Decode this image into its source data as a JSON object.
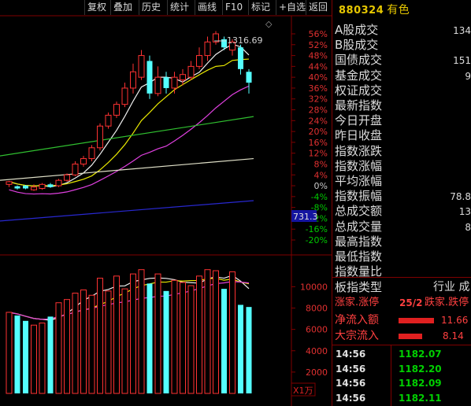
{
  "toolbar": {
    "items": [
      "复权",
      "叠加",
      "历史",
      "统计",
      "画线",
      "F10",
      "标记",
      "+自选",
      "返回"
    ]
  },
  "chart": {
    "high_label": "1316.69",
    "marker": "◇",
    "cursor_value": "731.3",
    "y_axis_pct": [
      "56%",
      "52%",
      "48%",
      "44%",
      "40%",
      "36%",
      "32%",
      "28%",
      "24%",
      "20%",
      "16%",
      "12%",
      "8%",
      "4%",
      "0%",
      "-4%",
      "-8%",
      "-12%",
      "-16%",
      "-20%"
    ],
    "vol_axis": [
      "10000",
      "8000",
      "6000",
      "4000",
      "2000"
    ],
    "vol_unit": "X1万"
  },
  "chart_data": {
    "type": "candlestick",
    "title": "",
    "candles": [
      {
        "o": 0.5,
        "c": 1.5,
        "h": 1.8,
        "l": -0.5,
        "up": true
      },
      {
        "o": -1,
        "c": -0.2,
        "h": 0.1,
        "l": -1.4,
        "up": false
      },
      {
        "o": 0,
        "c": -1,
        "h": 0.3,
        "l": -1.3,
        "up": false
      },
      {
        "o": -1.5,
        "c": -0.5,
        "h": 0.5,
        "l": -1.9,
        "up": true
      },
      {
        "o": -1,
        "c": 0.5,
        "h": 1,
        "l": -1.5,
        "up": true
      },
      {
        "o": 0.5,
        "c": -0.5,
        "h": 1,
        "l": -0.8,
        "up": false
      },
      {
        "o": 0,
        "c": 2,
        "h": 2.5,
        "l": -0.5,
        "up": true
      },
      {
        "o": 2,
        "c": 4,
        "h": 4.5,
        "l": 1.5,
        "up": true
      },
      {
        "o": 4,
        "c": 8,
        "h": 9,
        "l": 3.5,
        "up": true
      },
      {
        "o": 8,
        "c": 10,
        "h": 11,
        "l": 7,
        "up": true
      },
      {
        "o": 10,
        "c": 14,
        "h": 15,
        "l": 9,
        "up": true
      },
      {
        "o": 14,
        "c": 22,
        "h": 23,
        "l": 13,
        "up": true
      },
      {
        "o": 22,
        "c": 26,
        "h": 27,
        "l": 21,
        "up": true
      },
      {
        "o": 26,
        "c": 30,
        "h": 31,
        "l": 25,
        "up": true
      },
      {
        "o": 30,
        "c": 36,
        "h": 38,
        "l": 29,
        "up": true
      },
      {
        "o": 36,
        "c": 42,
        "h": 45,
        "l": 34,
        "up": true
      },
      {
        "o": 40,
        "c": 48,
        "h": 50,
        "l": 39,
        "up": true
      },
      {
        "o": 46,
        "c": 34,
        "h": 48,
        "l": 32,
        "up": false
      },
      {
        "o": 34,
        "c": 40,
        "h": 44,
        "l": 33,
        "up": true
      },
      {
        "o": 40,
        "c": 36,
        "h": 42,
        "l": 34,
        "up": false
      },
      {
        "o": 36,
        "c": 40,
        "h": 42,
        "l": 34,
        "up": true
      },
      {
        "o": 39,
        "c": 41,
        "h": 43,
        "l": 37,
        "up": true
      },
      {
        "o": 40,
        "c": 44,
        "h": 46,
        "l": 39,
        "up": true
      },
      {
        "o": 44,
        "c": 48,
        "h": 51,
        "l": 43,
        "up": true
      },
      {
        "o": 48,
        "c": 53,
        "h": 55,
        "l": 46,
        "up": true
      },
      {
        "o": 53,
        "c": 56,
        "h": 57,
        "l": 52,
        "up": true
      },
      {
        "o": 54,
        "c": 51,
        "h": 55,
        "l": 50,
        "up": false
      },
      {
        "o": 50,
        "c": 53,
        "h": 54,
        "l": 48,
        "up": true
      },
      {
        "o": 51,
        "c": 43,
        "h": 52,
        "l": 41,
        "up": false
      },
      {
        "o": 42,
        "c": 38,
        "h": 43,
        "l": 34,
        "up": false
      }
    ],
    "volumes": [
      7600,
      7300,
      6800,
      6400,
      6600,
      7200,
      8500,
      8800,
      9400,
      9700,
      9200,
      10800,
      9600,
      11000,
      9800,
      11200,
      11600,
      10300,
      11200,
      9600,
      10600,
      10400,
      10100,
      11000,
      11600,
      11500,
      9800,
      11400,
      8300,
      8100
    ],
    "volume_up": [
      true,
      false,
      false,
      true,
      true,
      false,
      true,
      true,
      true,
      true,
      true,
      true,
      true,
      true,
      true,
      true,
      true,
      false,
      true,
      false,
      true,
      true,
      true,
      true,
      true,
      true,
      false,
      true,
      false,
      false
    ],
    "ylim_pct": [
      -20,
      56
    ],
    "vol_ylim": [
      0,
      11800
    ]
  },
  "panel": {
    "code": "880324",
    "name": "有色",
    "rows": [
      {
        "label": "A股成交",
        "value": "134"
      },
      {
        "label": "B股成交",
        "value": ""
      },
      {
        "label": "国债成交",
        "value": "151"
      },
      {
        "label": "基金成交",
        "value": "9"
      },
      {
        "label": "权证成交",
        "value": ""
      },
      {
        "label": "最新指数",
        "value": ""
      },
      {
        "label": "今日开盘",
        "value": ""
      },
      {
        "label": "昨日收盘",
        "value": ""
      },
      {
        "label": "指数涨跌",
        "value": ""
      },
      {
        "label": "指数涨幅",
        "value": ""
      },
      {
        "label": "平均涨幅",
        "value": ""
      },
      {
        "label": "指数振幅",
        "value": "78.8"
      },
      {
        "label": "总成交额",
        "value": "13"
      },
      {
        "label": "总成交量",
        "value": "8"
      },
      {
        "label": "最高指数",
        "value": ""
      },
      {
        "label": "最低指数",
        "value": ""
      },
      {
        "label": "指数量比",
        "value": ""
      }
    ],
    "board_type_label": "板指类型",
    "board_type_value": "行业 成",
    "updown_label": "涨家.涨停",
    "updown_value": "25/2",
    "down_label": "跌家.跌停",
    "net_inflow_label": "净流入额",
    "net_inflow_value": "11.66",
    "block_label": "大宗流入",
    "block_value": "8.14",
    "ticks": [
      {
        "time": "14:56",
        "price": "1182.07"
      },
      {
        "time": "14:56",
        "price": "1182.20"
      },
      {
        "time": "14:56",
        "price": "1182.09"
      },
      {
        "time": "14:56",
        "price": "1182.11"
      }
    ],
    "colors": {
      "up": "#ff3232",
      "down": "#54ffff",
      "label_yellow": "#e6c700",
      "green": "#00d000"
    }
  }
}
